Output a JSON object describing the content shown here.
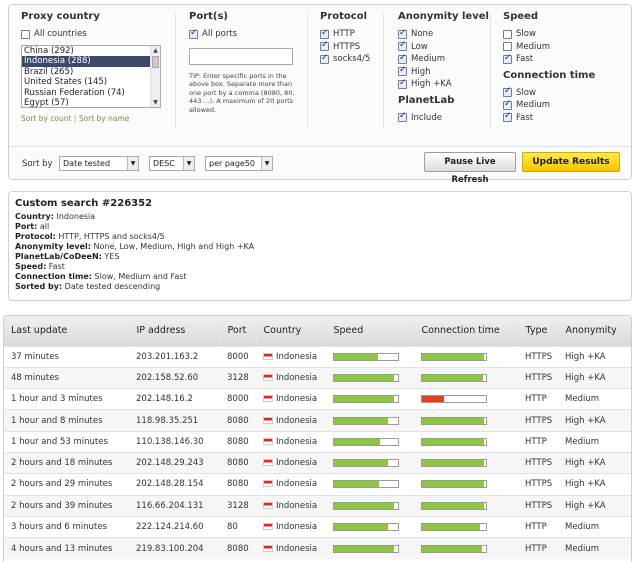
{
  "filters": {
    "proxy_country": {
      "title": "Proxy country",
      "all_label": "All countries",
      "all_checked": false,
      "countries": [
        "China (292)",
        "Indonesia (288)",
        "Brazil (265)",
        "United States (145)",
        "Russian Federation (74)",
        "Egypt (57)"
      ],
      "selected": "Indonesia (288)",
      "sort_by_count": "Sort by count",
      "sort_by_name": "Sort by name",
      "sort_sep": " | "
    },
    "ports": {
      "title": "Port(s)",
      "all_label": "All ports",
      "all_checked": true,
      "input_value": "",
      "tip": "TIP: Enter specific ports in the above box. Separate more than one port by a comma (8080, 80, 443 ...). A maximum of 20 ports allowed."
    },
    "protocol": {
      "title": "Protocol",
      "options": [
        {
          "label": "HTTP",
          "checked": true
        },
        {
          "label": "HTTPS",
          "checked": true
        },
        {
          "label": "socks4/5",
          "checked": true
        }
      ]
    },
    "anonymity": {
      "title": "Anonymity level",
      "options": [
        {
          "label": "None",
          "checked": true
        },
        {
          "label": "Low",
          "checked": true
        },
        {
          "label": "Medium",
          "checked": true
        },
        {
          "label": "High",
          "checked": true
        },
        {
          "label": "High +KA",
          "checked": true
        }
      ]
    },
    "planetlab": {
      "title": "PlanetLab",
      "include_label": "Include",
      "checked": true
    },
    "speed": {
      "title": "Speed",
      "options": [
        {
          "label": "Slow",
          "checked": false
        },
        {
          "label": "Medium",
          "checked": false
        },
        {
          "label": "Fast",
          "checked": true
        }
      ]
    },
    "connection_time": {
      "title": "Connection time",
      "options": [
        {
          "label": "Slow",
          "checked": true
        },
        {
          "label": "Medium",
          "checked": true
        },
        {
          "label": "Fast",
          "checked": true
        }
      ]
    },
    "sort": {
      "label": "Sort by",
      "field": "Date tested",
      "order": "DESC",
      "per_page": "per page50",
      "pause_button": "Pause Live Refresh",
      "update_button": "Update Results"
    }
  },
  "summary": {
    "title": "Custom search #226352",
    "lines": [
      {
        "key": "Country:",
        "value": " Indonesia"
      },
      {
        "key": "Port:",
        "value": " all"
      },
      {
        "key": "Protocol:",
        "value": " HTTP, HTTPS and socks4/5"
      },
      {
        "key": "Anonymity level:",
        "value": " None, Low, Medium, High and High +KA"
      },
      {
        "key": "PlanetLab/CoDeeN:",
        "value": " YES"
      },
      {
        "key": "Speed:",
        "value": " Fast"
      },
      {
        "key": "Connection time:",
        "value": " Slow, Medium and Fast"
      },
      {
        "key": "Sorted by:",
        "value": " Date tested descending"
      }
    ]
  },
  "table": {
    "headers": [
      "Last update",
      "IP address",
      "Port",
      "Country",
      "Speed",
      "Connection time",
      "Type",
      "Anonymity"
    ],
    "rows": [
      {
        "last_update": "37 minutes",
        "ip": "203.201.163.2",
        "port": "8000",
        "country": "Indonesia",
        "speed": 0.68,
        "conn": 0.97,
        "conn_color": "#8dc63f",
        "type": "HTTPS",
        "anonymity": "High +KA"
      },
      {
        "last_update": "48 minutes",
        "ip": "202.158.52.60",
        "port": "3128",
        "country": "Indonesia",
        "speed": 0.93,
        "conn": 0.95,
        "conn_color": "#8dc63f",
        "type": "HTTPS",
        "anonymity": "High +KA"
      },
      {
        "last_update": "1 hour and 3 minutes",
        "ip": "202.148.16.2",
        "port": "8000",
        "country": "Indonesia",
        "speed": 0.93,
        "conn": 0.34,
        "conn_color": "#e2401c",
        "type": "HTTP",
        "anonymity": "Medium"
      },
      {
        "last_update": "1 hour and 8 minutes",
        "ip": "118.98.35.251",
        "port": "8080",
        "country": "Indonesia",
        "speed": 0.85,
        "conn": 0.97,
        "conn_color": "#8dc63f",
        "type": "HTTPS",
        "anonymity": "High +KA"
      },
      {
        "last_update": "1 hour and 53 minutes",
        "ip": "110.138.146.30",
        "port": "8080",
        "country": "Indonesia",
        "speed": 0.72,
        "conn": 0.97,
        "conn_color": "#8dc63f",
        "type": "HTTP",
        "anonymity": "Medium"
      },
      {
        "last_update": "2 hours and 18 minutes",
        "ip": "202.148.29.243",
        "port": "8080",
        "country": "Indonesia",
        "speed": 0.85,
        "conn": 0.97,
        "conn_color": "#8dc63f",
        "type": "HTTPS",
        "anonymity": "High +KA"
      },
      {
        "last_update": "2 hours and 29 minutes",
        "ip": "202.148.28.154",
        "port": "8080",
        "country": "Indonesia",
        "speed": 0.7,
        "conn": 0.97,
        "conn_color": "#8dc63f",
        "type": "HTTPS",
        "anonymity": "High +KA"
      },
      {
        "last_update": "2 hours and 39 minutes",
        "ip": "116.66.204.131",
        "port": "3128",
        "country": "Indonesia",
        "speed": 0.93,
        "conn": 0.97,
        "conn_color": "#8dc63f",
        "type": "HTTPS",
        "anonymity": "High +KA"
      },
      {
        "last_update": "3 hours and 6 minutes",
        "ip": "222.124.214.60",
        "port": "80",
        "country": "Indonesia",
        "speed": 0.85,
        "conn": 0.9,
        "conn_color": "#8dc63f",
        "type": "HTTP",
        "anonymity": "Medium"
      },
      {
        "last_update": "4 hours and 13 minutes",
        "ip": "219.83.100.204",
        "port": "8080",
        "country": "Indonesia",
        "speed": 0.93,
        "conn": 0.93,
        "conn_color": "#8dc63f",
        "type": "HTTP",
        "anonymity": "Medium"
      }
    ]
  },
  "colors": {
    "speed_bar": "#8dc63f",
    "accent": "#f6c400",
    "link": "#6a9a3c"
  }
}
